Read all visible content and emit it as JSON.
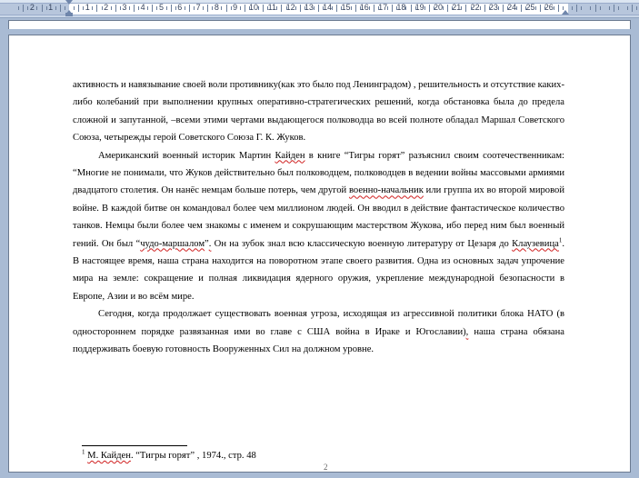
{
  "ruler": {
    "numbers": [
      "2",
      "1",
      "1",
      "2",
      "3",
      "4",
      "5",
      "6",
      "7",
      "8",
      "9",
      "10",
      "11",
      "12",
      "13",
      "14",
      "15",
      "16",
      "17",
      "18",
      "19",
      "20",
      "21",
      "22",
      "23",
      "24",
      "25",
      "26"
    ]
  },
  "document": {
    "p1": "активность и навязывание своей воли противнику(как это было под Ленинградом) , решительность и отсутствие каких-либо колебаний при выполнении крупных оперативно-стратегических решений, когда обстановка была до предела сложной и запутанной, –всеми этими чертами выдающегося полководца во всей полноте обладал Маршал Советского Союза, четырежды герой Советского Союза Г. К. Жуков.",
    "p2_a": "Американский военный историк Мартин ",
    "p2_kaiden": "Кайден",
    "p2_b": " в книге “Тигры горят” разъяснил своим соотечественникам: “Многие не понимали, что Жуков действительно был полководцем, полководцев в ведении войны массовыми армиями двадцатого столетия. Он нанёс немцам больше потерь, чем другой ",
    "p2_vn": "военно-начальник",
    "p2_c": " или группа их во второй мировой войне. В каждой битве он командовал более чем миллионом людей. Он вводил в действие фантастическое количество танков. Немцы были более чем знакомы с именем и сокрушающим мастерством Жукова, ибо перед ним был военный гений. Он был “",
    "p2_cm": "чудо-маршалом",
    "p2_d": "”",
    "p2_comma": ".",
    "p2_e": " Он на зубок знал всю классическую военную литературу от Цезаря до ",
    "p2_kl": "Клаузевица",
    "p2_sup": "1",
    "p2_f": ". В настоящее время, наша страна находится на поворотном этапе своего развития. Одна из основных задач упрочение мира на земле: сокращение и полная ликвидация ядерного оружия, укрепление международной безопасности в Европе, Азии и во всём мире.",
    "p3_a": "Сегодня, когда продолжает существовать военная угроза, исходящая из агрессивной политики блока НАТО (в одностороннем порядке развязанная ими во главе с США война в Ираке и Югославии)",
    "p3_mark": ",",
    "p3_b": " наша страна обязана поддерживать боевую готовность Вооруженных Сил на должном уровне.",
    "footnote_sup": "1",
    "footnote_name": "М. Кайден",
    "footnote_rest": ". “Тигры горят” , 1974., стр. 48",
    "page_number": "2"
  }
}
